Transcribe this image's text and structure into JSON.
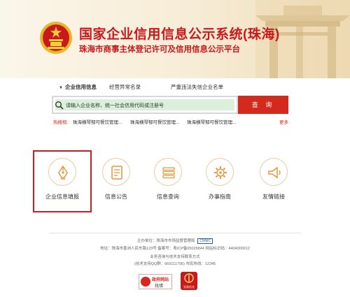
{
  "header": {
    "title": "国家企业信用信息公示系统(珠海)",
    "subtitle": "珠海市商事主体登记许可及信用信息公示平台"
  },
  "tabs": [
    {
      "label": "企业信用信息",
      "active": true
    },
    {
      "label": "经营异常名录",
      "active": false
    },
    {
      "label": "严重违法失信企业名单",
      "active": false
    }
  ],
  "search": {
    "placeholder": "请输入企业名称、统一社会信用代码或注册号",
    "button_label": "查 询"
  },
  "hot_search": {
    "label": "热搜榜:",
    "items": [
      "珠海横琴郁可餐饮管理...",
      "珠海横琴郁可餐饮管理...",
      "珠海横琴郁可餐饮管理..."
    ],
    "more": "更多"
  },
  "services": [
    {
      "label": "企业信息填报",
      "icon": "pen-nib-icon"
    },
    {
      "label": "信息公告",
      "icon": "document-icon"
    },
    {
      "label": "信息查询",
      "icon": "list-icon"
    },
    {
      "label": "办事指南",
      "icon": "gear-icon"
    },
    {
      "label": "友情链接",
      "icon": "megaphone-icon"
    }
  ],
  "footer": {
    "sponsor": "主办单位：珠海市市场监督管理局",
    "sponsor_badge": "CNNIC",
    "address": "地址：珠海市香洲人民东路123号  备案号：粤ICP备05026844  网站标识码：4404000012",
    "support_title": "业务咨询与技术支持联系方式",
    "support_contact": "(技术支持QQ群：669111795)  市民热线：12345",
    "gov_site_line1": "政府网站",
    "gov_site_line2": "找错",
    "party_badge": "党政机关"
  },
  "colors": {
    "brand_red": "#c8191c",
    "search_bg": "#daf0da",
    "button_red": "#d42a1e",
    "highlight_border": "#e0161a"
  }
}
